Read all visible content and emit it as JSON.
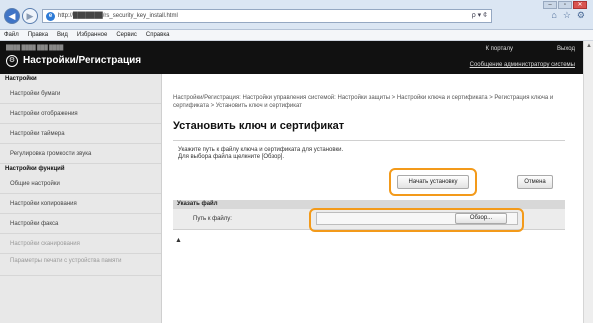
{
  "browser": {
    "url": "http://███████/rs_security_key_install.html",
    "addr_tools": "ρ ▾ ¢",
    "window_buttons": [
      "–",
      "▫",
      "✕"
    ]
  },
  "menu": [
    "Файл",
    "Правка",
    "Вид",
    "Избранное",
    "Сервис",
    "Справка"
  ],
  "header": {
    "model": "████ ████ ███ ████",
    "title": "Настройки/Регистрация",
    "portal": "К порталу",
    "logout": "Выход",
    "admin_msg": "Сообщение администратору системы"
  },
  "sidebar": {
    "section1": "Настройки",
    "items1": [
      "Настройки бумаги",
      "Настройки отображения",
      "Настройки таймера",
      "Регулировка громкости звука"
    ],
    "section2": "Настройки функций",
    "items2": [
      "Общие настройки",
      "Настройки копирования",
      "Настройки факса",
      "Настройки сканирования",
      "Параметры печати с устройства памяти"
    ]
  },
  "main": {
    "breadcrumb": "Настройки/Регистрация: Настройки управления системой: Настройки защиты > Настройки ключа и сертификата > Регистрация ключа и сертификата > Установить ключ и сертификат",
    "title": "Установить ключ и сертификат",
    "instruction_line1": "Укажите путь к файлу ключа и сертификата для установки.",
    "instruction_line2": "Для выбора файла щелкните [Обзор].",
    "start_button": "Начать установку",
    "cancel_button": "Отмена",
    "section_title": "Указать файл",
    "path_label": "Путь к файлу:",
    "path_value": "",
    "browse_button": "Обзор...",
    "top_link": "▲"
  },
  "colors": {
    "highlight": "#f39a1a",
    "header_bg": "#111111",
    "sidebar_bg": "#e8e8e8"
  }
}
